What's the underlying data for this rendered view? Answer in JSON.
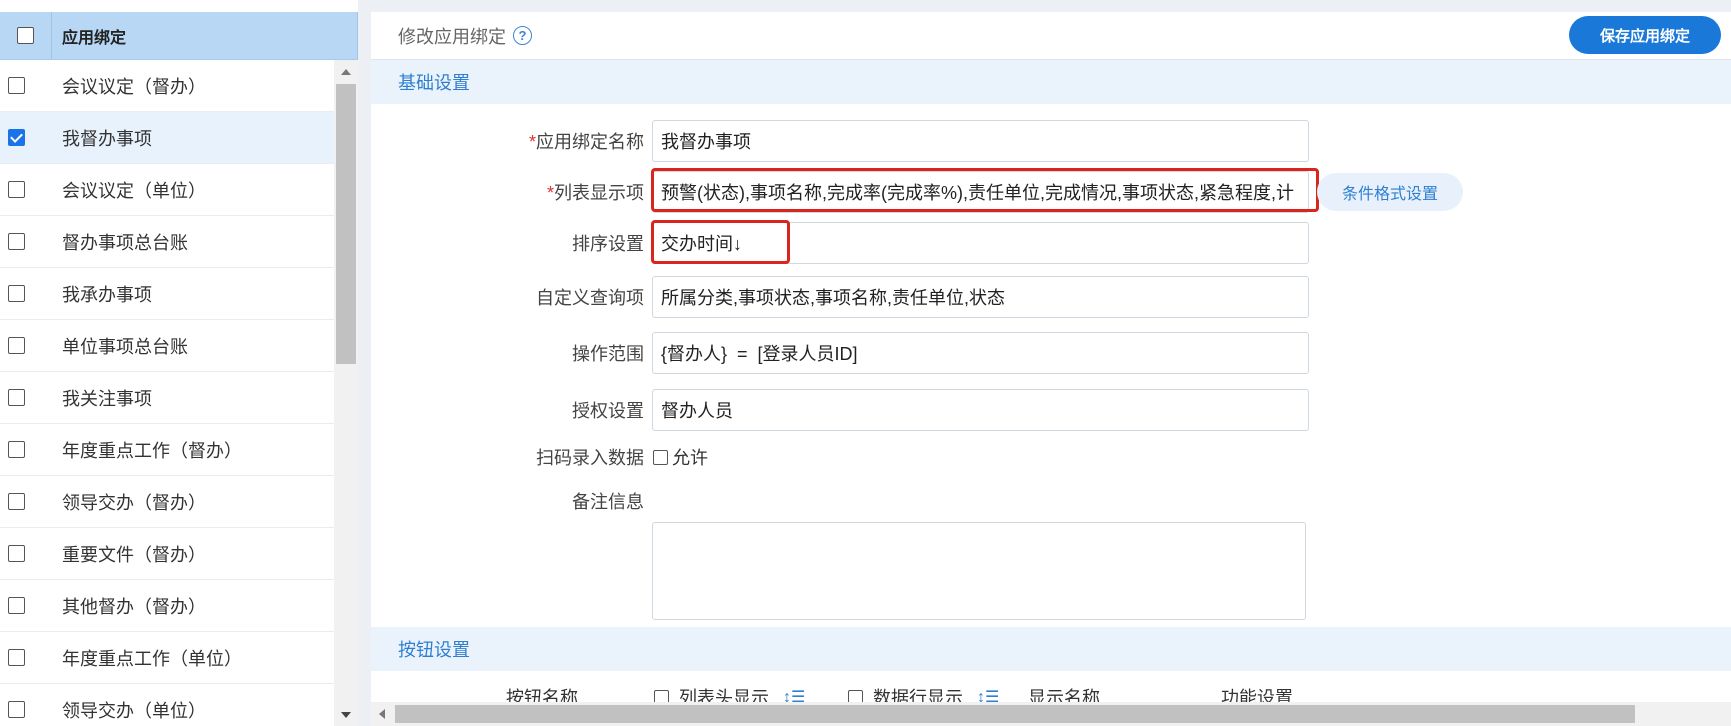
{
  "left_panel": {
    "header_label": "应用绑定",
    "header_checked": false,
    "items": [
      {
        "label": "会议议定（督办）",
        "checked": false
      },
      {
        "label": "我督办事项",
        "checked": true
      },
      {
        "label": "会议议定（单位）",
        "checked": false
      },
      {
        "label": "督办事项总台账",
        "checked": false
      },
      {
        "label": "我承办事项",
        "checked": false
      },
      {
        "label": "单位事项总台账",
        "checked": false
      },
      {
        "label": "我关注事项",
        "checked": false
      },
      {
        "label": "年度重点工作（督办）",
        "checked": false
      },
      {
        "label": "领导交办（督办）",
        "checked": false
      },
      {
        "label": "重要文件（督办）",
        "checked": false
      },
      {
        "label": "其他督办（督办）",
        "checked": false
      },
      {
        "label": "年度重点工作（单位）",
        "checked": false
      },
      {
        "label": "领导交办（单位）",
        "checked": false
      }
    ]
  },
  "header": {
    "title": "修改应用绑定",
    "help_icon": "?",
    "save_label": "保存应用绑定"
  },
  "basic_section": {
    "title": "基础设置",
    "fields": {
      "name_label": "应用绑定名称",
      "name_value": "我督办事项",
      "columns_label": "列表显示项",
      "columns_value": "预警(状态),事项名称,完成率(完成率%),责任单位,完成情况,事项状态,紧急程度,计",
      "condition_button": "条件格式设置",
      "sort_label": "排序设置",
      "sort_value": "交办时间↓",
      "query_label": "自定义查询项",
      "query_value": "所属分类,事项状态,事项名称,责任单位,状态",
      "scope_label": "操作范围",
      "scope_value": "{督办人}  =  [登录人员ID]",
      "auth_label": "授权设置",
      "auth_value": "督办人员",
      "scan_label": "扫码录入数据",
      "scan_option": "允许",
      "scan_checked": false,
      "remark_label": "备注信息",
      "remark_value": ""
    },
    "required_mark": "*"
  },
  "button_section": {
    "title": "按钮设置",
    "columns": {
      "name": "按钮名称",
      "header_display": "列表头显示",
      "row_display": "数据行显示",
      "display_name": "显示名称",
      "function": "功能设置"
    },
    "sort_icon": "↕☰"
  },
  "colors": {
    "accent": "#1a78d9",
    "selected_row": "#e8f2fd",
    "left_header": "#b7d7f5",
    "highlight": "#d9251d",
    "section_bg": "#eaf3fb"
  }
}
